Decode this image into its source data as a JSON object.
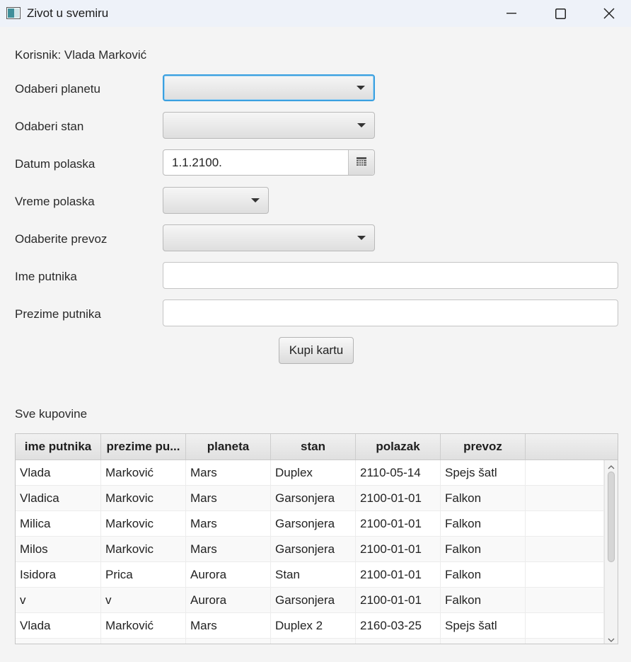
{
  "window": {
    "title": "Zivot u svemiru",
    "icons": [
      "app-icon",
      "minimize-icon",
      "maximize-icon",
      "close-icon"
    ]
  },
  "form": {
    "user_label": "Korisnik: Vlada Marković",
    "planet_label": "Odaberi planetu",
    "planet_value": "",
    "apartment_label": "Odaberi stan",
    "apartment_value": "",
    "departure_date_label": "Datum polaska",
    "departure_date_value": "1.1.2100.",
    "departure_time_label": "Vreme polaska",
    "departure_time_value": "",
    "transport_label": "Odaberite prevoz",
    "transport_value": "",
    "first_name_label": "Ime putnika",
    "first_name_value": "",
    "last_name_label": "Prezime putnika",
    "last_name_value": "",
    "buy_button": "Kupi kartu"
  },
  "purchases": {
    "title": "Sve kupovine",
    "columns": [
      "ime putnika",
      "prezime pu...",
      "planeta",
      "stan",
      "polazak",
      "prevoz"
    ],
    "rows": [
      [
        "Vlada",
        "Marković",
        "Mars",
        "Duplex",
        "2110-05-14",
        "Spejs šatl"
      ],
      [
        "Vladica",
        "Markovic",
        "Mars",
        "Garsonjera",
        "2100-01-01",
        "Falkon"
      ],
      [
        "Milica",
        "Markovic",
        "Mars",
        "Garsonjera",
        "2100-01-01",
        "Falkon"
      ],
      [
        "Milos",
        "Markovic",
        "Mars",
        "Garsonjera",
        "2100-01-01",
        "Falkon"
      ],
      [
        "Isidora",
        "Prica",
        "Aurora",
        "Stan",
        "2100-01-01",
        "Falkon"
      ],
      [
        "v",
        "v",
        "Aurora",
        "Garsonjera",
        "2100-01-01",
        "Falkon"
      ],
      [
        "Vlada",
        "Marković",
        "Mars",
        "Duplex 2",
        "2160-03-25",
        "Spejs šatl"
      ]
    ]
  },
  "colors": {
    "focus_border": "#3aa0e0",
    "titlebar_bg": "#eef2f9",
    "window_bg": "#f4f4f4"
  }
}
